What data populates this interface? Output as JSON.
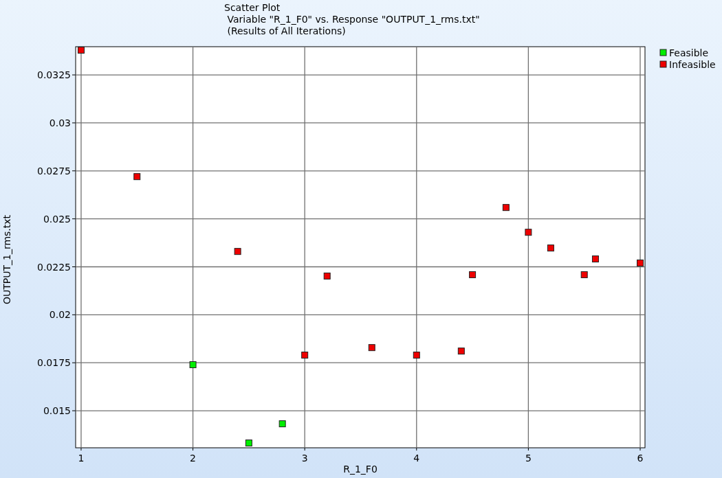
{
  "chart_data": {
    "type": "scatter",
    "grid": true,
    "legend": true,
    "title": "Scatter Plot\n Variable \"R_1_F0\" vs. Response \"OUTPUT_1_rms.txt\"\n (Results of All Iterations)",
    "xlabel": "R_1_F0",
    "ylabel": "OUTPUT_1_rms.txt",
    "xlim": [
      0.951,
      6.043
    ],
    "ylim": [
      0.01307,
      0.03397
    ],
    "xticks": [
      1,
      2,
      3,
      4,
      5,
      6
    ],
    "yticks": [
      {
        "value": 0.015,
        "label": "0.015"
      },
      {
        "value": 0.0175,
        "label": "0.0175"
      },
      {
        "value": 0.02,
        "label": "0.02"
      },
      {
        "value": 0.0225,
        "label": "0.0225"
      },
      {
        "value": 0.025,
        "label": "0.025"
      },
      {
        "value": 0.0275,
        "label": "0.0275"
      },
      {
        "value": 0.03,
        "label": "0.03"
      },
      {
        "value": 0.0325,
        "label": "0.0325"
      }
    ],
    "series": [
      {
        "name": "Feasible",
        "color": "#00ee00",
        "x": [
          2.0,
          2.5,
          2.8
        ],
        "values": [
          0.0174,
          0.01332,
          0.01432
        ]
      },
      {
        "name": "Infeasible",
        "color": "#ee0000",
        "x": [
          1.0,
          1.5,
          2.4,
          3.0,
          3.2,
          3.6,
          4.0,
          4.4,
          4.5,
          4.8,
          5.0,
          5.2,
          5.5,
          5.6,
          6.0
        ],
        "values": [
          0.03379,
          0.0272,
          0.0233,
          0.0179,
          0.02202,
          0.01829,
          0.0179,
          0.01811,
          0.02209,
          0.02559,
          0.0243,
          0.02348,
          0.02209,
          0.02291,
          0.0227
        ]
      }
    ]
  }
}
